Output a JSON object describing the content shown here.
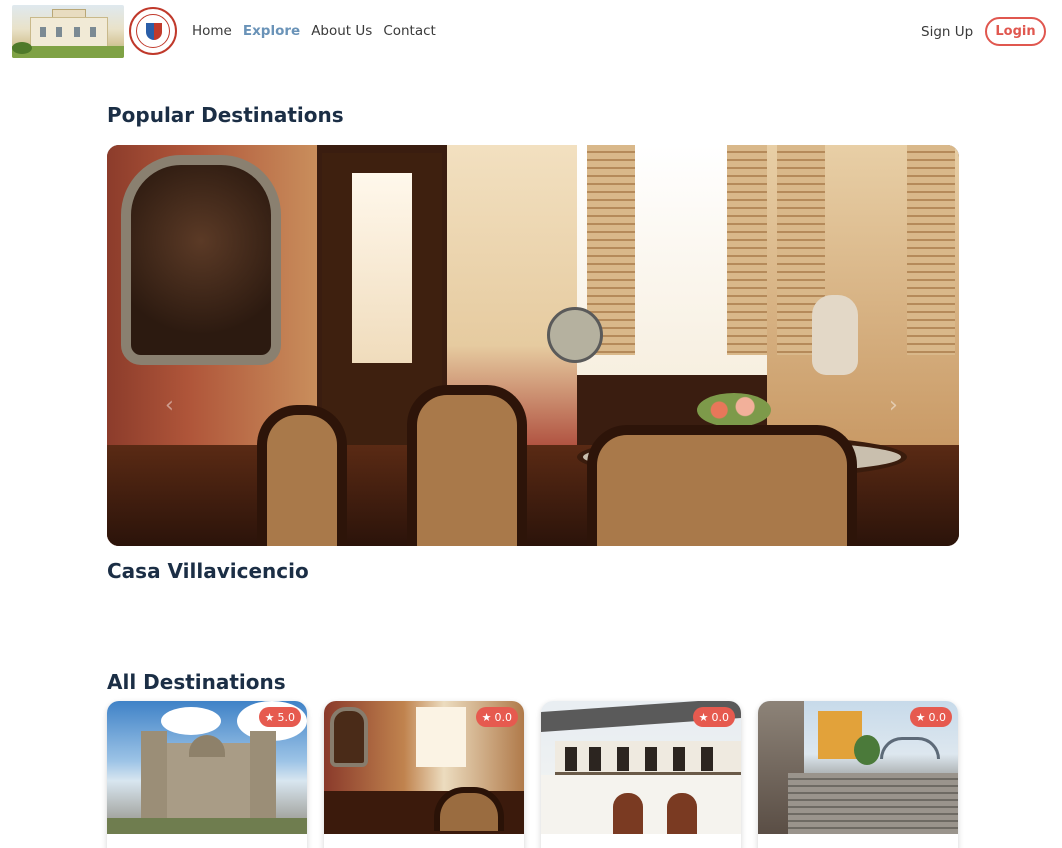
{
  "nav": {
    "links": [
      {
        "label": "Home"
      },
      {
        "label": "Explore"
      },
      {
        "label": "About Us"
      },
      {
        "label": "Contact"
      }
    ],
    "signup": "Sign Up",
    "login": "Login",
    "active_link": "Explore"
  },
  "popular": {
    "title": "Popular Destinations",
    "current_caption": "Casa Villavicencio",
    "prev_icon": "chevron-left-icon",
    "next_icon": "chevron-right-icon"
  },
  "all_destinations": {
    "title": "All Destinations",
    "cards": [
      {
        "rating": "5.0",
        "image": "church-photo"
      },
      {
        "rating": "0.0",
        "image": "heritage-interior-photo"
      },
      {
        "rating": "0.0",
        "image": "heritage-house-photo"
      },
      {
        "rating": "0.0",
        "image": "stairway-street-photo"
      }
    ],
    "rating_icon": "star-icon",
    "star_glyph": "★"
  },
  "colors": {
    "accent": "#e0574f",
    "active_nav": "#6a93b8",
    "heading": "#1b2e45",
    "rating_badge": "#e65a4f"
  }
}
